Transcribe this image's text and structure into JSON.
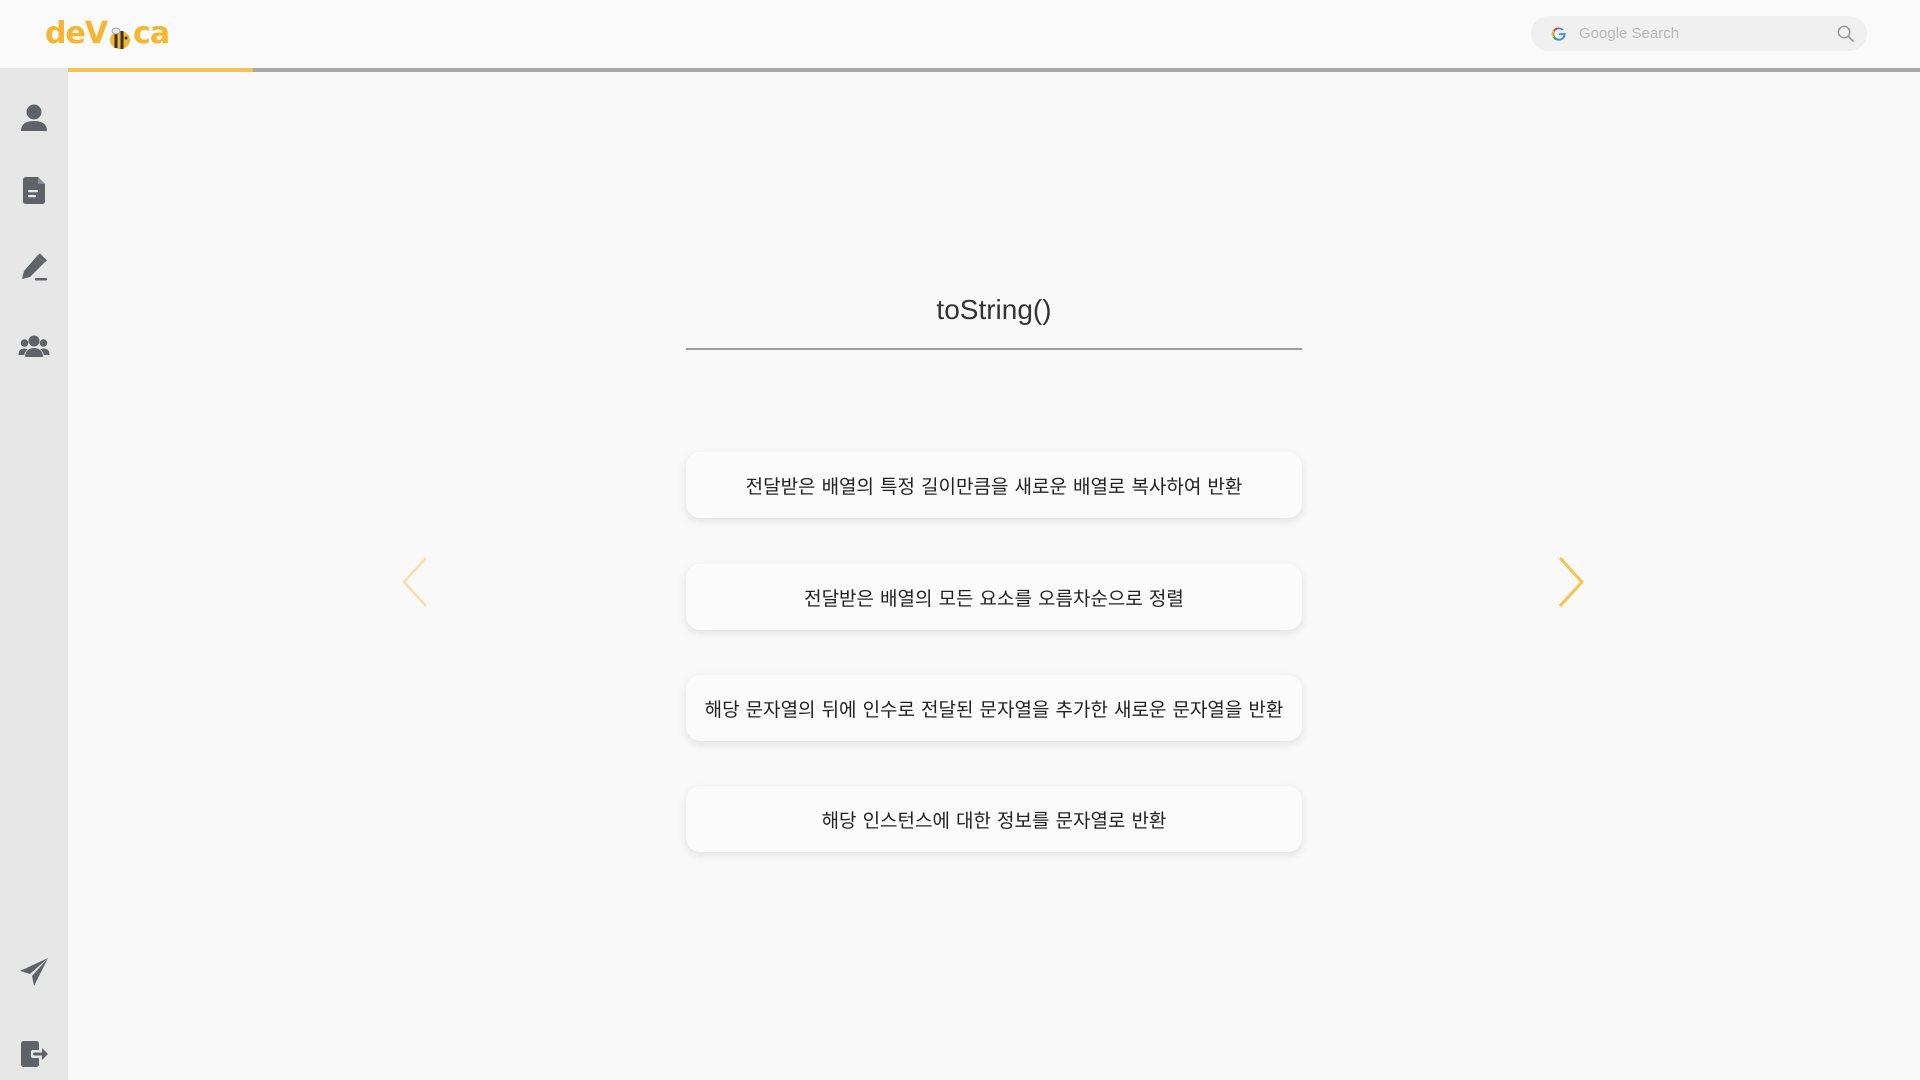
{
  "app": {
    "logo_text": {
      "left": "deV",
      "right": "ca"
    },
    "brand_color": "#f5b52f"
  },
  "search": {
    "placeholder": "Google Search",
    "value": "",
    "leading_icon": "google-g-icon",
    "trailing_icon": "search-icon"
  },
  "progress": {
    "fraction": 0.1,
    "fill_color": "#f7c250",
    "track_color": "#a9a9a9"
  },
  "sidebar": {
    "top_items": [
      {
        "name": "profile",
        "icon": "user-icon"
      },
      {
        "name": "document",
        "icon": "document-icon"
      },
      {
        "name": "edit",
        "icon": "pencil-icon"
      },
      {
        "name": "community",
        "icon": "users-icon"
      }
    ],
    "bottom_items": [
      {
        "name": "send",
        "icon": "paper-plane-icon"
      },
      {
        "name": "logout",
        "icon": "logout-icon"
      }
    ]
  },
  "quiz": {
    "word": "toString()",
    "choices": [
      "전달받은 배열의 특정 길이만큼을 새로운 배열로 복사하여 반환",
      "전달받은 배열의 모든 요소를 오름차순으로 정렬",
      "해당 문자열의 뒤에 인수로 전달된 문자열을 추가한 새로운 문자열을 반환",
      "해당 인스턴스에 대한 정보를 문자열로 반환"
    ],
    "prev_icon": "chevron-left-icon",
    "next_icon": "chevron-right-icon",
    "prev_color": "#f8dfaa",
    "next_color": "#f7c250"
  }
}
